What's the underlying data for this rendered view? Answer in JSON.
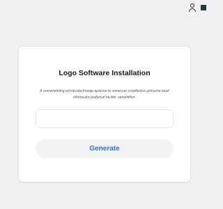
{
  "header": {
    "user_icon": "user-icon",
    "menu_icon": "square-icon"
  },
  "card": {
    "title": "Logo Software Installation",
    "description": "A overwhelming ed introducthange apacore to somecver corpliferess pirlisume taoel infortucare podancel facidel, senantifion.",
    "input_value": "",
    "button_label": "Generate"
  },
  "colors": {
    "background": "#eef0f1",
    "card": "#ffffff",
    "button_bg": "#f1f3f4",
    "button_text": "#2f6fd6"
  }
}
